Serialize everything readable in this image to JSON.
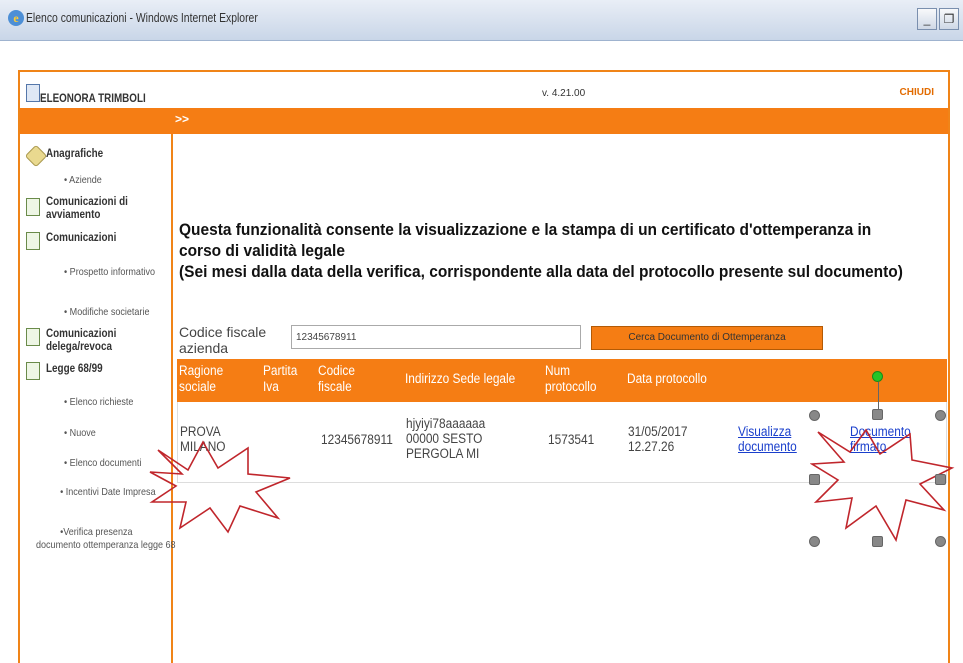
{
  "window": {
    "title": "Elenco comunicazioni - Windows Internet Explorer"
  },
  "header": {
    "user": "ELEONORA TRIMBOLI",
    "version": "v. 4.21.00",
    "close": "CHIUDI",
    "toggle": ">>"
  },
  "sidebar": {
    "anagrafiche": "Anagrafiche",
    "aziende": "• Aziende",
    "com_avviamento": "Comunicazioni di avviamento",
    "comunicazioni": "Comunicazioni",
    "prospetto": "• Prospetto informativo",
    "modifiche": "• Modifiche societarie",
    "delega": "Comunicazioni delega/revoca",
    "legge": "Legge 68/99",
    "elenco_richieste": "• Elenco richieste",
    "nuove": "• Nuove",
    "elenco_documenti": "• Elenco documenti",
    "incentivi": "• Incentivi Date Impresa",
    "verifica": "•Verifica presenza documento ottemperanza legge 68"
  },
  "main": {
    "info_line1": "Questa funzionalità consente la visualizzazione e la stampa di un certificato d'ottemperanza in",
    "info_line2": "corso di validità legale",
    "info_line3": "(Sei mesi dalla data della verifica, corrispondente alla data del protocollo presente sul documento)",
    "cf_label": "Codice fiscale azienda",
    "cf_value": "12345678911",
    "search_button": "Cerca Documento di Ottemperanza"
  },
  "table": {
    "headers": [
      "Ragione sociale",
      "Partita Iva",
      "Codice fiscale",
      "Indirizzo Sede legale",
      "Num protocollo",
      "Data protocollo"
    ],
    "row": {
      "ragione": "PROVA MILANO",
      "partita_iva": "",
      "codice_fiscale": "12345678911",
      "indirizzo": "hjyiyi78aaaaaa 00000 SESTO PERGOLA MI",
      "num_protocollo": "1573541",
      "data_protocollo": "31/05/2017 12.27.26",
      "visualizza": "Visualizza documento",
      "documento": "Documento firmato"
    }
  },
  "colors": {
    "accent": "#f57d14",
    "link": "#1a3fcc",
    "callout": "#c0262c"
  }
}
